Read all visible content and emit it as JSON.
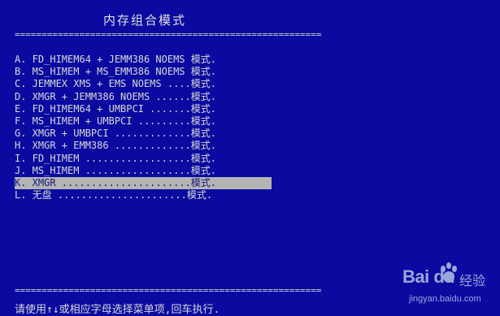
{
  "title": "内存组合模式",
  "rule": "=========================================================",
  "menu_items": [
    {
      "key": "A",
      "text": "A. FD_HIMEM64 + JEMM386 NOEMS 模式.",
      "selected": false
    },
    {
      "key": "B",
      "text": "B. MS_HIMEM + MS_EMM386 NOEMS 模式.",
      "selected": false
    },
    {
      "key": "C",
      "text": "C. JEMMEX XMS + EMS NOEMS ....模式.",
      "selected": false
    },
    {
      "key": "D",
      "text": "D. XMGR + JEMM386 NOEMS ......模式.",
      "selected": false
    },
    {
      "key": "E",
      "text": "E. FD_HIMEM64 + UMBPCI .......模式.",
      "selected": false
    },
    {
      "key": "F",
      "text": "F. MS_HIMEM + UMBPCI .........模式.",
      "selected": false
    },
    {
      "key": "G",
      "text": "G. XMGR + UMBPCI .............模式.",
      "selected": false
    },
    {
      "key": "H",
      "text": "H. XMGR + EMM386 .............模式.",
      "selected": false
    },
    {
      "key": "I",
      "text": "I. FD_HIMEM ..................模式.",
      "selected": false
    },
    {
      "key": "J",
      "text": "J. MS_HIMEM ..................模式.",
      "selected": false
    },
    {
      "key": "K",
      "text": "K. XMGR ......................模式.",
      "selected": true
    },
    {
      "key": "L",
      "text": "L. 无盘 ......................模式.",
      "selected": false
    }
  ],
  "help_text": "请使用↑↓或相应字母选择菜单项,回车执行.",
  "watermark": {
    "logo": "Bai  du",
    "brand": "经验",
    "url": "jingyan.baidu.com"
  },
  "colors": {
    "background": "#0a0aa0",
    "text": "#d8d8d8",
    "highlight": "#b4b4b4"
  }
}
